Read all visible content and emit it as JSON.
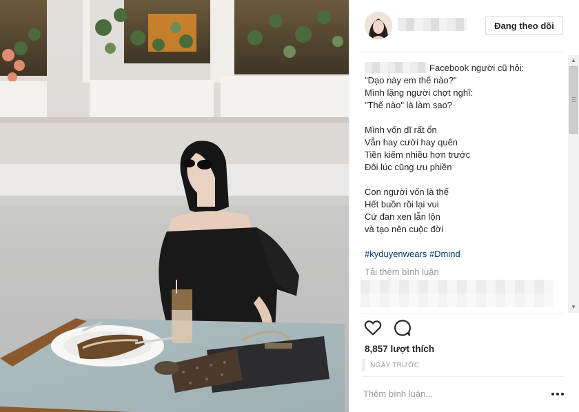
{
  "post": {
    "follow_label": "Đang theo dõi",
    "caption": {
      "first_line": "Facebook người cũ hỏi:",
      "lines_1": [
        "\"Dạo này em thế nào?\"",
        "Mình lặng người chợt nghĩ:",
        "\"Thế nào\" là làm sao?"
      ],
      "lines_2": [
        "Mình vốn dĩ rất ổn",
        "Vẫn hay cười hay quên",
        "Tiền kiếm nhiều hơn trước",
        "Đôi lúc cũng ưu phiền"
      ],
      "lines_3": [
        "Con người vốn là thế",
        "Hết buồn rồi lại vui",
        "Cứ đan xen lẫn lộn",
        "và tạo nên cuộc đời"
      ],
      "hashtags": "#kyduyenwears #Dmind"
    },
    "load_more_comments": "Tải thêm bình luận",
    "likes": "8,857 lượt thích",
    "timestamp": "NGÀY TRƯỚC",
    "comment_placeholder": "Thêm bình luận..."
  },
  "icons": {
    "like": "heart-icon",
    "comment": "speech-bubble-icon",
    "more": "ellipsis-icon",
    "scroll_up": "arrow-up-icon",
    "scroll_down": "arrow-down-icon"
  },
  "colors": {
    "text": "#262626",
    "secondary": "#999999",
    "link": "#003569",
    "border": "#efefef"
  }
}
